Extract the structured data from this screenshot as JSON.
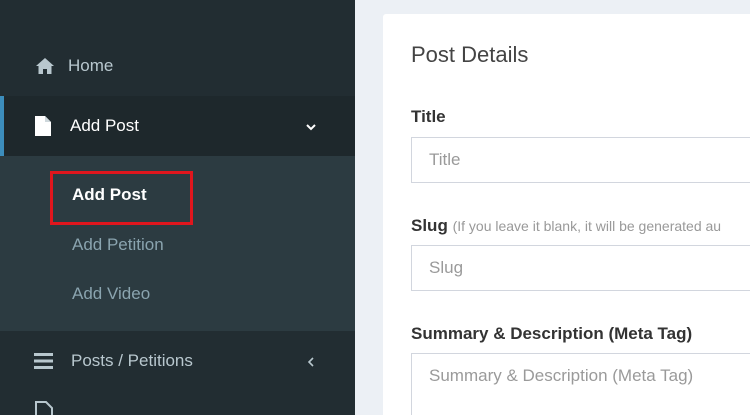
{
  "sidebar": {
    "home_label": "Home",
    "add_post_label": "Add Post",
    "submenu": [
      {
        "label": "Add Post"
      },
      {
        "label": "Add Petition"
      },
      {
        "label": "Add Video"
      }
    ],
    "posts_label": "Posts / Petitions",
    "accent_color": "#3c8dbc",
    "highlight_color": "#e0161d"
  },
  "form": {
    "title": "Post Details",
    "title_field": {
      "label": "Title",
      "placeholder": "Title",
      "value": ""
    },
    "slug_field": {
      "label": "Slug",
      "hint": "(If you leave it blank, it will be generated au",
      "placeholder": "Slug",
      "value": ""
    },
    "summary_field": {
      "label": "Summary & Description (Meta Tag)",
      "placeholder": "Summary & Description (Meta Tag)",
      "value": ""
    }
  }
}
